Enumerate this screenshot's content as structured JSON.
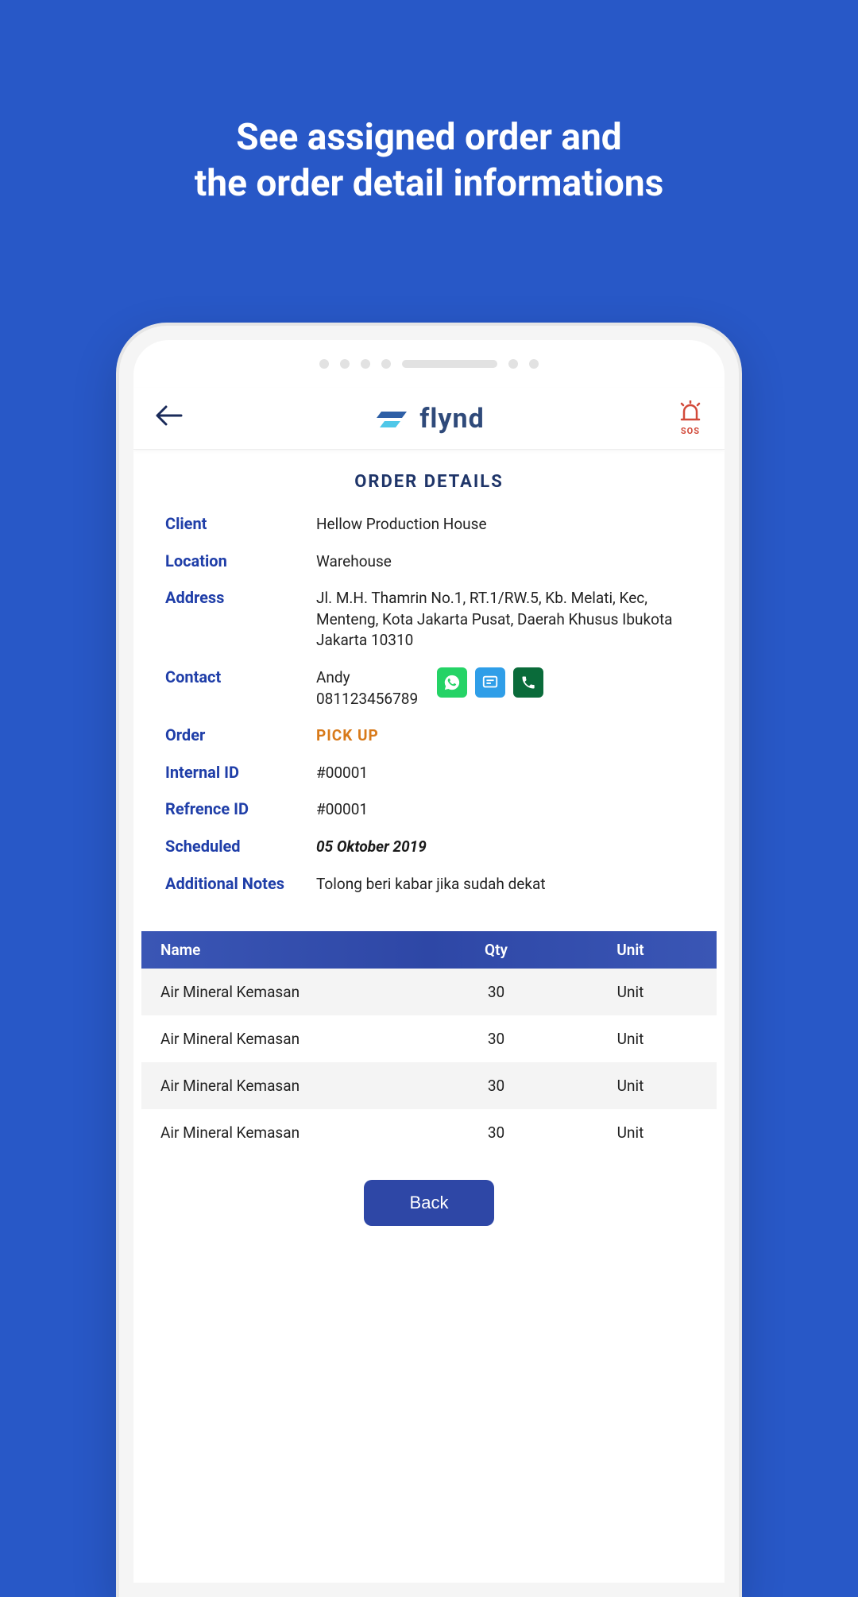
{
  "promo": {
    "title_line1": "See assigned order and",
    "title_line2": "the order detail informations"
  },
  "header": {
    "brand": "flynd",
    "sos_label": "SOS"
  },
  "screen": {
    "title": "ORDER DETAILS"
  },
  "labels": {
    "client": "Client",
    "location": "Location",
    "address": "Address",
    "contact": "Contact",
    "order": "Order",
    "internal_id": "Internal ID",
    "reference_id": "Refrence ID",
    "scheduled": "Scheduled",
    "additional_notes": "Additional Notes"
  },
  "values": {
    "client": "Hellow Production House",
    "location": "Warehouse",
    "address": "Jl. M.H. Thamrin No.1, RT.1/RW.5, Kb. Melati, Kec, Menteng, Kota Jakarta Pusat, Daerah Khusus Ibukota Jakarta 10310",
    "contact_name": "Andy",
    "contact_phone": "081123456789",
    "order_type": "PICK UP",
    "internal_id": "#00001",
    "reference_id": "#00001",
    "scheduled": "05 Oktober 2019",
    "additional_notes": "Tolong beri kabar jika sudah dekat"
  },
  "items_table": {
    "headers": {
      "name": "Name",
      "qty": "Qty",
      "unit": "Unit"
    },
    "rows": [
      {
        "name": "Air Mineral Kemasan",
        "qty": "30",
        "unit": "Unit"
      },
      {
        "name": "Air Mineral Kemasan",
        "qty": "30",
        "unit": "Unit"
      },
      {
        "name": "Air Mineral Kemasan",
        "qty": "30",
        "unit": "Unit"
      },
      {
        "name": "Air Mineral Kemasan",
        "qty": "30",
        "unit": "Unit"
      }
    ]
  },
  "buttons": {
    "back": "Back"
  },
  "colors": {
    "brand_blue": "#2858c7",
    "accent_orange": "#d87a1a",
    "sos_red": "#d24a3a"
  }
}
